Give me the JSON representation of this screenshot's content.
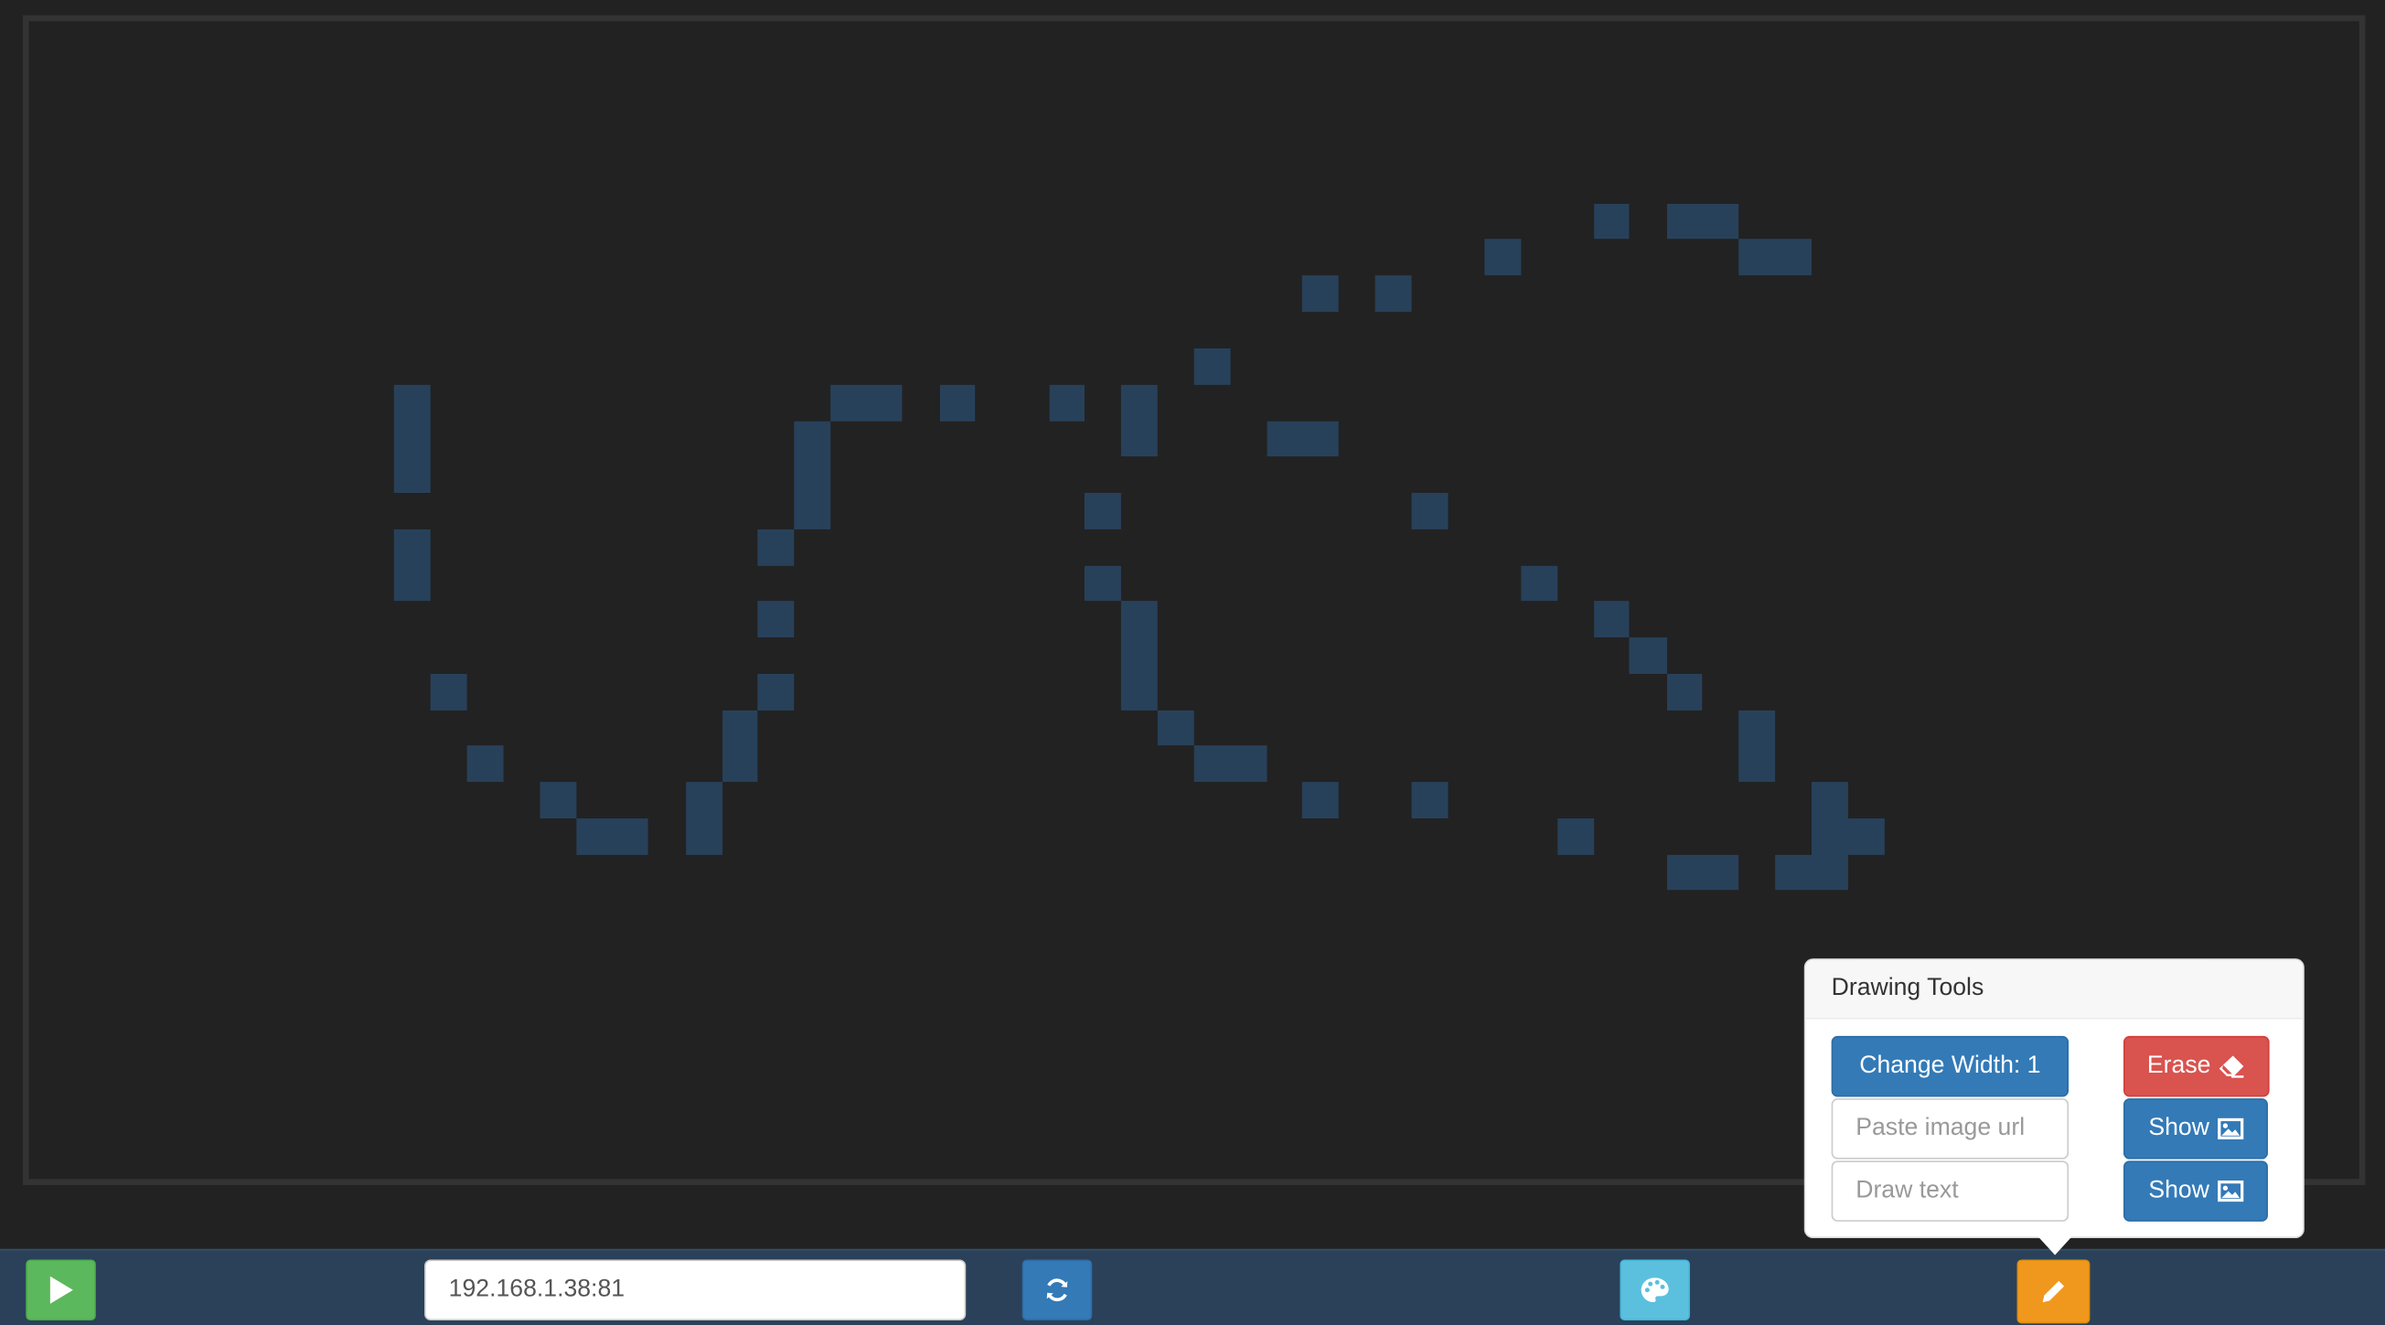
{
  "canvas": {
    "background": "#222222",
    "pixel_color": "#28415a"
  },
  "drawing_tools": {
    "title": "Drawing Tools",
    "change_width_label": "Change Width: 1",
    "erase_label": "Erase",
    "image_url_placeholder": "Paste image url",
    "image_show_label": "Show",
    "text_placeholder": "Draw text",
    "text_show_label": "Show"
  },
  "bottom_bar": {
    "address_value": "192.168.1.38:81",
    "icons": {
      "play": "play-icon",
      "refresh": "refresh-icon",
      "palette": "palette-icon",
      "pencil": "pencil-icon",
      "eraser": "eraser-icon",
      "image": "image-icon"
    }
  },
  "colors": {
    "bar": "#2a4159",
    "play": "#5cb85c",
    "primary": "#337ab7",
    "info": "#5bc0de",
    "warning": "#f0981e",
    "danger": "#d9534f"
  }
}
